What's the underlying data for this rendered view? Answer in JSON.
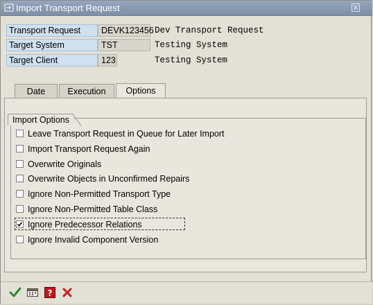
{
  "window": {
    "title": "Import Transport Request"
  },
  "header": {
    "rows": [
      {
        "label": "Transport Request",
        "value": "DEVK123456",
        "description": "Dev Transport Request"
      },
      {
        "label": "Target System",
        "value": "TST",
        "description": "Testing System"
      },
      {
        "label": "Target Client",
        "value": "123",
        "description": "Testing System"
      }
    ]
  },
  "tabs": [
    {
      "label": "Date",
      "active": false
    },
    {
      "label": "Execution",
      "active": false
    },
    {
      "label": "Options",
      "active": true
    }
  ],
  "group": {
    "title": "Import Options",
    "options": [
      {
        "label": "Leave Transport Request in Queue for Later Import",
        "checked": false
      },
      {
        "label": "Import Transport Request Again",
        "checked": false
      },
      {
        "label": "Overwrite Originals",
        "checked": false
      },
      {
        "label": "Overwrite Objects in Unconfirmed Repairs",
        "checked": false
      },
      {
        "label": "Ignore Non-Permitted Transport Type",
        "checked": false
      },
      {
        "label": "Ignore Non-Permitted Table Class",
        "checked": false
      },
      {
        "label": "Ignore Predecessor Relations",
        "checked": true
      },
      {
        "label": "Ignore Invalid Component Version",
        "checked": false
      }
    ]
  },
  "footer": {
    "buttons": [
      {
        "icon": "checkmark-icon"
      },
      {
        "icon": "schedule-icon"
      },
      {
        "icon": "help-icon"
      },
      {
        "icon": "cancel-icon"
      }
    ]
  },
  "colors": {
    "titlebar": "#8a9ab2",
    "label_bg": "#cfe0f0",
    "panel_bg": "#e9e6dd",
    "accept_green": "#2e8b2e",
    "cancel_red": "#c81e1e"
  }
}
